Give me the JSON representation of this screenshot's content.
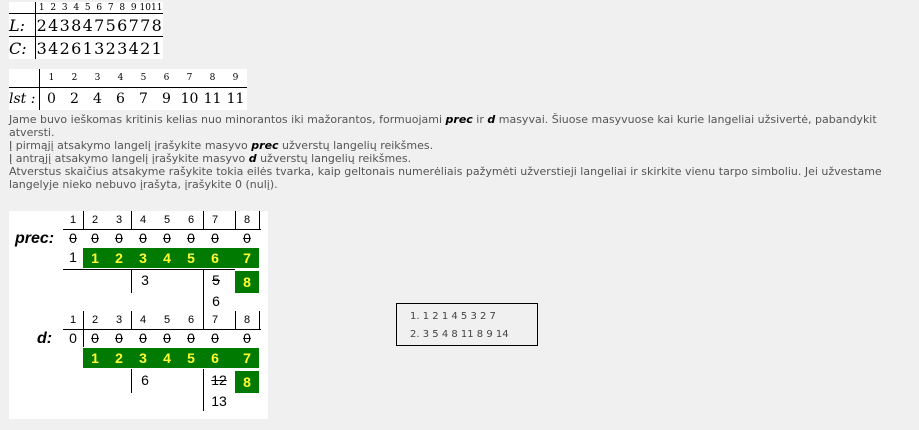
{
  "lc_table": {
    "columns": [
      "1",
      "2",
      "3",
      "4",
      "5",
      "6",
      "7",
      "8",
      "9",
      "10",
      "11"
    ],
    "rows": [
      {
        "label": "L:",
        "values": [
          "2",
          "4",
          "3",
          "8",
          "4",
          "7",
          "5",
          "6",
          "7",
          "7",
          "8"
        ]
      },
      {
        "label": "C:",
        "values": [
          "3",
          "4",
          "2",
          "6",
          "1",
          "3",
          "2",
          "3",
          "4",
          "2",
          "1"
        ]
      }
    ]
  },
  "lst_table": {
    "columns": [
      "1",
      "2",
      "3",
      "4",
      "5",
      "6",
      "7",
      "8",
      "9"
    ],
    "label": "lst :",
    "values": [
      "0",
      "2",
      "4",
      "6",
      "7",
      "9",
      "10",
      "11",
      "11"
    ]
  },
  "instructions": {
    "line1_a": "Jame buvo ieškomas kritinis kelias nuo minorantos iki mažorantos, formuojami ",
    "line1_prec": "prec",
    "line1_b": " ir ",
    "line1_d": "d",
    "line1_c": " masyvai. Šiuose masyvuose kai kurie langeliai užsivertė, pabandykit",
    "line2": "atversti.",
    "line3_a": "Į pirmąjį atsakymo langelį įrašykite masyvo ",
    "line3_prec": "prec",
    "line3_b": " užverstų langelių reikšmes.",
    "line4_a": "Į antrąjį atsakymo langelį įrašykite masyvo ",
    "line4_d": "d",
    "line4_b": " užverstų langelių reikšmes.",
    "line5": "Atverstus skaičius atsakyme rašykite tokia eilės tvarka, kaip geltonais numerėliais pažymėti užverstieji langeliai ir skirkite vienu tarpo simboliu. Jei užvestame",
    "line6": "langelyje nieko nebuvo įrašyta, įrašykite 0 (nulį)."
  },
  "figure": {
    "columns": [
      "1",
      "2",
      "3",
      "4",
      "5",
      "6",
      "7",
      "8"
    ],
    "prec": {
      "label": "prec:",
      "struck_row": [
        "0",
        "0",
        "0",
        "0",
        "0",
        "0",
        "0",
        "0"
      ],
      "first_value": "1",
      "hidden_numbers": [
        "1",
        "2",
        "3",
        "4",
        "5",
        "6",
        "7",
        "8"
      ],
      "below": {
        "col4": "3",
        "col7_struck": "5",
        "col7": "6"
      }
    },
    "d": {
      "label": "d:",
      "first_value": "0",
      "struck_row": [
        "0",
        "0",
        "0",
        "0",
        "0",
        "0",
        "0"
      ],
      "hidden_numbers": [
        "1",
        "2",
        "3",
        "4",
        "5",
        "6",
        "7",
        "8"
      ],
      "below": {
        "col4": "6",
        "col7_struck": "12",
        "col7": "13"
      }
    }
  },
  "answers": [
    {
      "label": "1.",
      "value": "1 2 1 4 5 3 2 7"
    },
    {
      "label": "2.",
      "value": "3 5 4 8 11 8 9 14"
    }
  ],
  "colors": {
    "green": "#007a00",
    "yellow": "#ffff33"
  }
}
